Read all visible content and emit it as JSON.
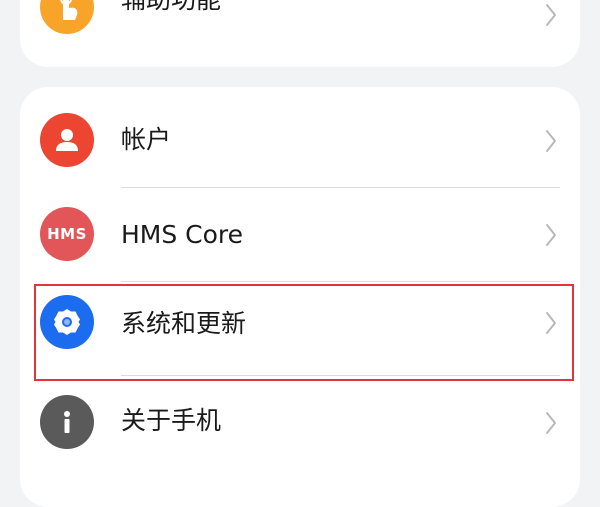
{
  "settings_list": {
    "items": [
      {
        "label": "辅助功能",
        "icon": "accessibility-hand-icon",
        "color": "#f8a428"
      },
      {
        "label": "帐户",
        "icon": "account-person-icon",
        "color": "#ec4532"
      },
      {
        "label": "HMS Core",
        "icon": "hms-core-icon",
        "icon_text": "HMS",
        "color": "#e25659"
      },
      {
        "label": "系统和更新",
        "icon": "gear-icon",
        "color": "#1c6cf0"
      },
      {
        "label": "关于手机",
        "icon": "info-icon",
        "color": "#5a5a5a"
      }
    ]
  },
  "highlight_color": "#e0353a"
}
